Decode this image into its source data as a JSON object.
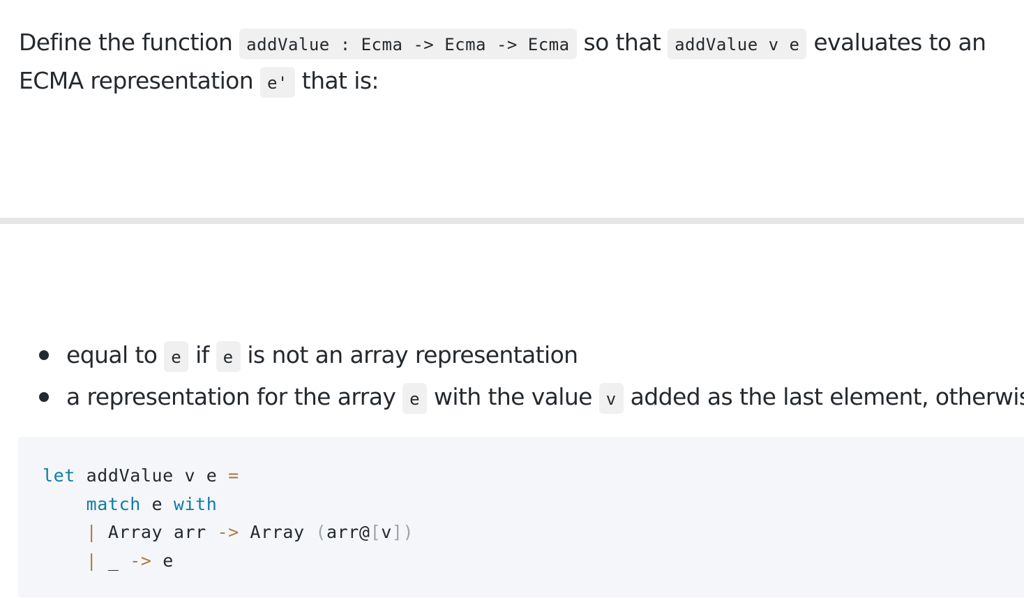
{
  "intro": {
    "t1": "Define the function ",
    "c1": "addValue : Ecma -> Ecma -> Ecma",
    "t2": " so that ",
    "c2": "addValue v e",
    "t3": " evaluates to an ECMA representation ",
    "c3": "e'",
    "t4": " that is:"
  },
  "bullets": [
    {
      "t1": "equal to ",
      "c1": "e",
      "t2": " if ",
      "c2": "e",
      "t3": " is not an array representation"
    },
    {
      "t1": "a representation for the array ",
      "c1": "e",
      "t2": " with the value ",
      "c2": "v",
      "t3": " added as the last element, otherwise."
    }
  ],
  "code": {
    "line1": {
      "kw": "let",
      "rest": " addValue v e ",
      "eq": "="
    },
    "line2": {
      "indent": "    ",
      "kw1": "match",
      "mid": " e ",
      "kw2": "with"
    },
    "line3": {
      "indent": "    ",
      "bar": "|",
      "a": " Array arr ",
      "arrow": "->",
      "b": " Array ",
      "lp": "(",
      "arr": "arr@",
      "lb": "[",
      "v": "v",
      "rb": "]",
      "rp": ")"
    },
    "line4": {
      "indent": "    ",
      "bar": "|",
      "a": " _ ",
      "arrow": "->",
      "b": " e"
    }
  },
  "colors": {
    "keyword": "#0e7ca5",
    "operator": "#a67d44",
    "punctuation": "#a0a4a9",
    "text": "#24292e",
    "inline_code_bg": "#f0f0f0",
    "code_block_bg": "#f5f6f9",
    "divider": "#e6e6e6"
  }
}
